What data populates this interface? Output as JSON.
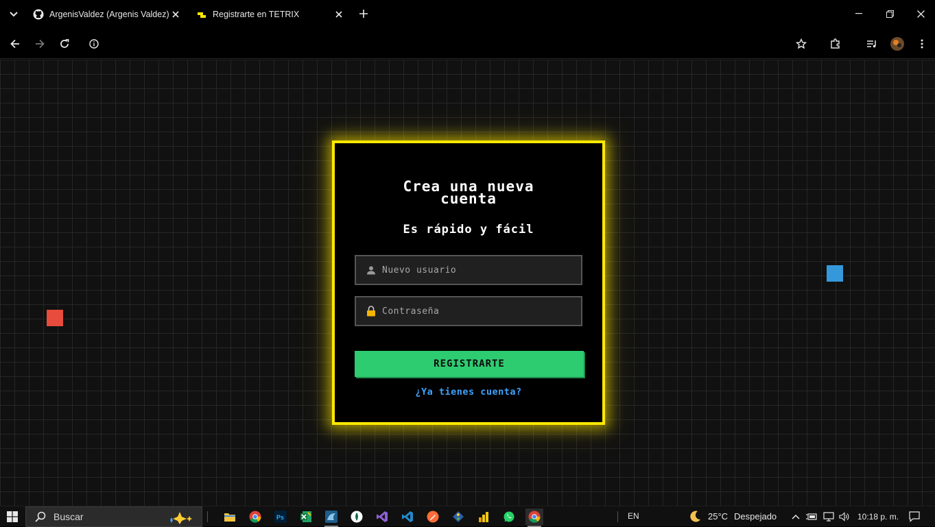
{
  "browser": {
    "tabs": [
      {
        "title": "ArgenisValdez (Argenis Valdez)",
        "favicon": "github-icon"
      },
      {
        "title": "Registrarte en TETRIX",
        "favicon": "tetrix-icon",
        "active": true
      }
    ]
  },
  "form": {
    "title_line1": "Crea una nueva",
    "title_line2": "cuenta",
    "subtitle": "Es rápido y fácil",
    "username_placeholder": "Nuevo usuario",
    "password_placeholder": "Contraseña",
    "submit_label": "REGISTRARTE",
    "login_link": "¿Ya tienes cuenta?"
  },
  "colors": {
    "card_border": "#ffe800",
    "submit_bg": "#2ecc71",
    "link": "#3fa4ff",
    "red_block": "#e74c3c",
    "blue_block": "#3498db"
  },
  "taskbar": {
    "search_placeholder": "Buscar",
    "language": "EN",
    "temperature": "25°C",
    "weather": "Despejado",
    "time": "10:18 p. m."
  }
}
